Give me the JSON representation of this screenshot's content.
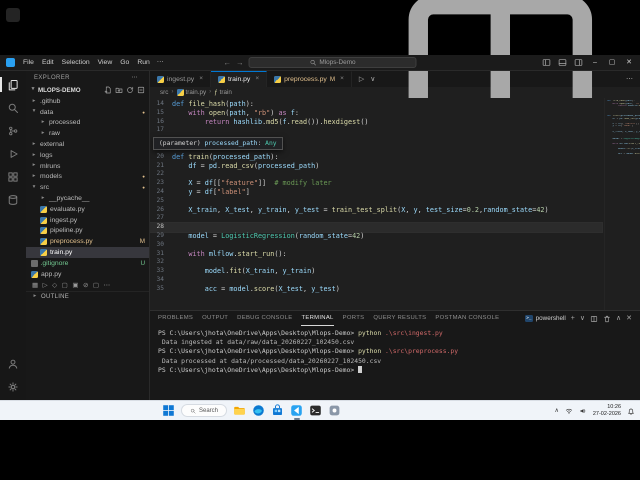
{
  "titlebar": {
    "menu": [
      "File",
      "Edit",
      "Selection",
      "View",
      "Go",
      "Run"
    ],
    "search": "Mlops-Demo"
  },
  "activity_bar": {
    "top": [
      "explorer",
      "search",
      "source-control",
      "run-debug",
      "extensions",
      "database"
    ],
    "bottom": [
      "account",
      "settings"
    ]
  },
  "sidebar": {
    "header": "EXPLORER",
    "section": "MLOPS-DEMO",
    "tree": [
      {
        "label": ".github",
        "type": "folder",
        "indent": 0
      },
      {
        "label": "data",
        "type": "folder-open",
        "indent": 0,
        "dot": true
      },
      {
        "label": "processed",
        "type": "folder",
        "indent": 1
      },
      {
        "label": "raw",
        "type": "folder",
        "indent": 1
      },
      {
        "label": "external",
        "type": "folder",
        "indent": 0
      },
      {
        "label": "logs",
        "type": "folder",
        "indent": 0
      },
      {
        "label": "mlruns",
        "type": "folder",
        "indent": 0
      },
      {
        "label": "models",
        "type": "folder",
        "indent": 0,
        "dot": true
      },
      {
        "label": "src",
        "type": "folder-open",
        "indent": 0,
        "dot": true
      },
      {
        "label": "__pycache__",
        "type": "folder",
        "indent": 1
      },
      {
        "label": "evaluate.py",
        "type": "py",
        "indent": 1
      },
      {
        "label": "ingest.py",
        "type": "py",
        "indent": 1
      },
      {
        "label": "pipeline.py",
        "type": "py",
        "indent": 1
      },
      {
        "label": "preprocess.py",
        "type": "py",
        "indent": 1,
        "badge": "M"
      },
      {
        "label": "train.py",
        "type": "py",
        "indent": 1,
        "selected": true
      },
      {
        "label": ".gitignore",
        "type": "file",
        "indent": 0,
        "badge": "U"
      },
      {
        "label": "app.py",
        "type": "py",
        "indent": 0
      }
    ],
    "footer_icons": [
      "▦",
      "▷",
      "◇",
      "▢",
      "▣",
      "⊘",
      "▢",
      "⋯"
    ],
    "outline": "OUTLINE"
  },
  "tabs": [
    {
      "label": "ingest.py",
      "icon": "py"
    },
    {
      "label": "train.py",
      "icon": "py",
      "active": true
    },
    {
      "label": "preprocess.py",
      "icon": "py",
      "badge": "M"
    }
  ],
  "breadcrumb": [
    {
      "label": "src"
    },
    {
      "label": "train.py",
      "icon": "py"
    },
    {
      "label": "train",
      "icon": "fn"
    }
  ],
  "editor": {
    "hover": [
      [
        "pn",
        "(parameter) "
      ],
      [
        "var",
        "processed_path"
      ],
      [
        "pn",
        ": "
      ],
      [
        "cls",
        "Any"
      ]
    ],
    "lines": [
      {
        "n": 14,
        "s": [
          [
            "kw",
            "def "
          ],
          [
            "fn",
            "file_hash"
          ],
          [
            "pn",
            "("
          ],
          [
            "var",
            "path"
          ],
          [
            "pn",
            "):"
          ]
        ]
      },
      {
        "n": 15,
        "s": [
          [
            "pn",
            "    "
          ],
          [
            "ctl",
            "with "
          ],
          [
            "fn",
            "open"
          ],
          [
            "pn",
            "("
          ],
          [
            "var",
            "path"
          ],
          [
            "pn",
            ", "
          ],
          [
            "str",
            "\"rb\""
          ],
          [
            "pn",
            ") "
          ],
          [
            "ctl",
            "as "
          ],
          [
            "var",
            "f"
          ],
          [
            "pn",
            ":"
          ]
        ]
      },
      {
        "n": 16,
        "s": [
          [
            "pn",
            "        "
          ],
          [
            "ctl",
            "return "
          ],
          [
            "var",
            "hashlib"
          ],
          [
            "pn",
            "."
          ],
          [
            "fn",
            "md5"
          ],
          [
            "pn",
            "("
          ],
          [
            "var",
            "f"
          ],
          [
            "pn",
            "."
          ],
          [
            "fn",
            "read"
          ],
          [
            "pn",
            "())."
          ],
          [
            "fn",
            "hexdigest"
          ],
          [
            "pn",
            "()"
          ]
        ]
      },
      {
        "n": 17,
        "s": []
      },
      {
        "hover": true
      },
      {
        "n": 20,
        "s": [
          [
            "kw",
            "def "
          ],
          [
            "fn",
            "train"
          ],
          [
            "pn",
            "("
          ],
          [
            "var",
            "processed_path"
          ],
          [
            "pn",
            "):"
          ]
        ]
      },
      {
        "n": 21,
        "s": [
          [
            "pn",
            "    "
          ],
          [
            "var",
            "df"
          ],
          [
            "pn",
            " = "
          ],
          [
            "var",
            "pd"
          ],
          [
            "pn",
            "."
          ],
          [
            "fn",
            "read_csv"
          ],
          [
            "pn",
            "("
          ],
          [
            "var",
            "processed_path"
          ],
          [
            "pn",
            ")"
          ]
        ]
      },
      {
        "n": 22,
        "s": []
      },
      {
        "n": 23,
        "s": [
          [
            "pn",
            "    "
          ],
          [
            "var",
            "X"
          ],
          [
            "pn",
            " = "
          ],
          [
            "var",
            "df"
          ],
          [
            "pn",
            "[["
          ],
          [
            "str",
            "\"feature\""
          ],
          [
            "pn",
            "]]  "
          ],
          [
            "com",
            "# modify later"
          ]
        ]
      },
      {
        "n": 24,
        "s": [
          [
            "pn",
            "    "
          ],
          [
            "var",
            "y"
          ],
          [
            "pn",
            " = "
          ],
          [
            "var",
            "df"
          ],
          [
            "pn",
            "["
          ],
          [
            "str",
            "\"label\""
          ],
          [
            "pn",
            "]"
          ]
        ]
      },
      {
        "n": 25,
        "s": []
      },
      {
        "n": 26,
        "s": [
          [
            "pn",
            "    "
          ],
          [
            "var",
            "X_train"
          ],
          [
            "pn",
            ", "
          ],
          [
            "var",
            "X_test"
          ],
          [
            "pn",
            ", "
          ],
          [
            "var",
            "y_train"
          ],
          [
            "pn",
            ", "
          ],
          [
            "var",
            "y_test"
          ],
          [
            "pn",
            " = "
          ],
          [
            "fn",
            "train_test_split"
          ],
          [
            "pn",
            "("
          ],
          [
            "var",
            "X"
          ],
          [
            "pn",
            ", "
          ],
          [
            "var",
            "y"
          ],
          [
            "pn",
            ", "
          ],
          [
            "var",
            "test_size"
          ],
          [
            "pn",
            "="
          ],
          [
            "num",
            "0.2"
          ],
          [
            "pn",
            ","
          ],
          [
            "var",
            "random_state"
          ],
          [
            "pn",
            "="
          ],
          [
            "num",
            "42"
          ],
          [
            "pn",
            ")"
          ]
        ]
      },
      {
        "n": 27,
        "s": []
      },
      {
        "n": 28,
        "s": [],
        "current": true
      },
      {
        "n": 29,
        "s": [
          [
            "pn",
            "    "
          ],
          [
            "var",
            "model"
          ],
          [
            "pn",
            " = "
          ],
          [
            "cls",
            "LogisticRegression"
          ],
          [
            "pn",
            "("
          ],
          [
            "var",
            "random_state"
          ],
          [
            "pn",
            "="
          ],
          [
            "num",
            "42"
          ],
          [
            "pn",
            ")"
          ]
        ]
      },
      {
        "n": 30,
        "s": []
      },
      {
        "n": 31,
        "s": [
          [
            "pn",
            "    "
          ],
          [
            "ctl",
            "with "
          ],
          [
            "var",
            "mlflow"
          ],
          [
            "pn",
            "."
          ],
          [
            "fn",
            "start_run"
          ],
          [
            "pn",
            "():"
          ]
        ]
      },
      {
        "n": 32,
        "s": []
      },
      {
        "n": 33,
        "s": [
          [
            "pn",
            "        "
          ],
          [
            "var",
            "model"
          ],
          [
            "pn",
            "."
          ],
          [
            "fn",
            "fit"
          ],
          [
            "pn",
            "("
          ],
          [
            "var",
            "X_train"
          ],
          [
            "pn",
            ", "
          ],
          [
            "var",
            "y_train"
          ],
          [
            "pn",
            ")"
          ]
        ]
      },
      {
        "n": 34,
        "s": []
      },
      {
        "n": 35,
        "s": [
          [
            "pn",
            "        "
          ],
          [
            "var",
            "acc"
          ],
          [
            "pn",
            " = "
          ],
          [
            "var",
            "model"
          ],
          [
            "pn",
            "."
          ],
          [
            "fn",
            "score"
          ],
          [
            "pn",
            "("
          ],
          [
            "var",
            "X_test"
          ],
          [
            "pn",
            ", "
          ],
          [
            "var",
            "y_test"
          ],
          [
            "pn",
            ")"
          ]
        ]
      }
    ]
  },
  "panel": {
    "tabs": [
      "PROBLEMS",
      "OUTPUT",
      "DEBUG CONSOLE",
      "TERMINAL",
      "PORTS",
      "QUERY RESULTS",
      "POSTMAN CONSOLE"
    ],
    "active_tab": "TERMINAL",
    "shell_label": "powershell",
    "terminal_lines": [
      [
        [
          "prompt",
          "PS C:\\Users\\jhota\\OneDrive\\Apps\\Desktop\\Mlops-Demo> "
        ],
        [
          "cmd",
          "python"
        ],
        [
          "arg",
          " .\\src\\ingest.py"
        ]
      ],
      [
        [
          "out",
          " Data ingested at data/raw/data_20260227_102450.csv"
        ]
      ],
      [
        [
          "prompt",
          "PS C:\\Users\\jhota\\OneDrive\\Apps\\Desktop\\Mlops-Demo> "
        ],
        [
          "cmd",
          "python"
        ],
        [
          "arg",
          " .\\src\\preprocess.py"
        ]
      ],
      [
        [
          "out",
          " Data processed at data/processed/data_20260227_102450.csv"
        ]
      ],
      [
        [
          "prompt",
          "PS C:\\Users\\jhota\\OneDrive\\Apps\\Desktop\\Mlops-Demo> "
        ],
        [
          "cursor",
          ""
        ]
      ]
    ]
  },
  "taskbar": {
    "search_label": "Search",
    "apps": [
      "file-explorer",
      "edge",
      "store",
      "vscode",
      "terminal",
      "app"
    ],
    "active_app": "vscode",
    "time": "10:26",
    "date": "27-02-2026"
  },
  "colors": {
    "accent": "#0078d4",
    "modified": "#e2c08d",
    "untracked": "#73c991"
  }
}
